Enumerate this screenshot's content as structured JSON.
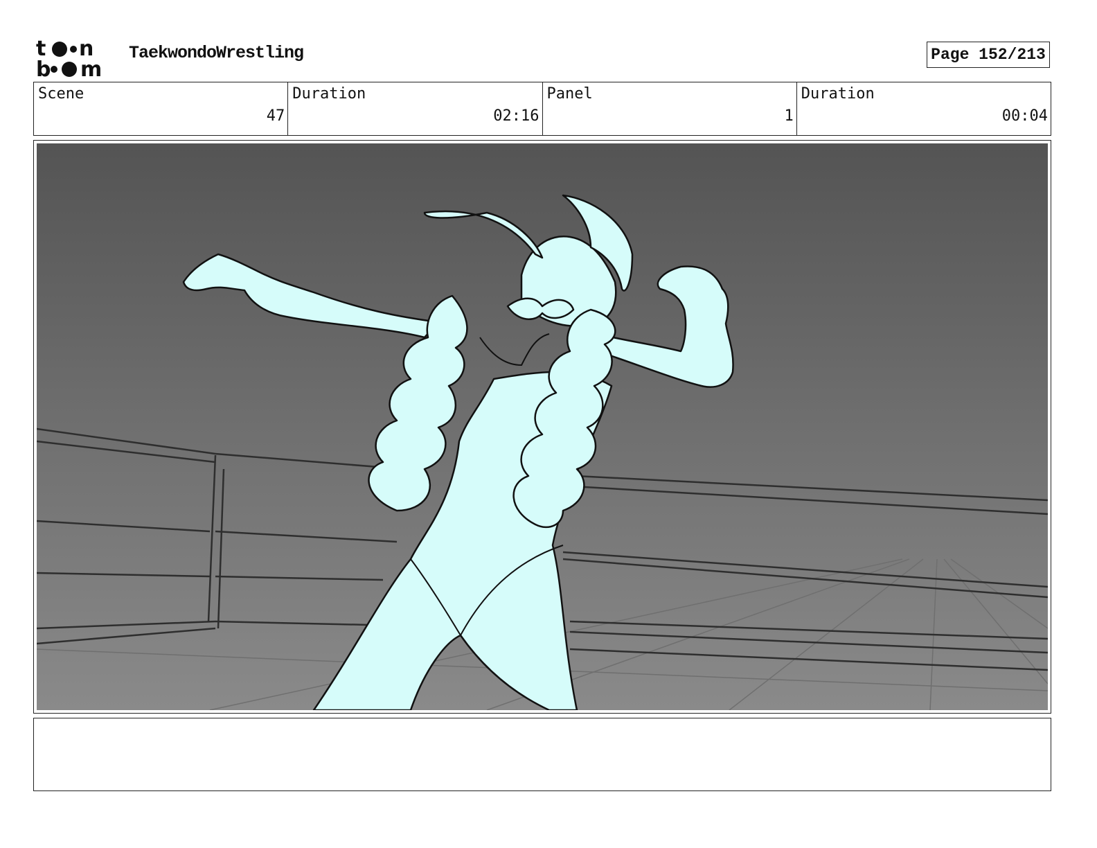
{
  "header": {
    "logo_text": "toon boom",
    "project_title": "TaekwondoWrestling",
    "page_label": "Page 152/213"
  },
  "info": {
    "scene_label": "Scene",
    "scene_value": "47",
    "scene_duration_label": "Duration",
    "scene_duration_value": "02:16",
    "panel_label": "Panel",
    "panel_value": "1",
    "panel_duration_label": "Duration",
    "panel_duration_value": "00:04"
  },
  "notes": {
    "text": ""
  },
  "colors": {
    "character_fill": "#d6fcfa",
    "background_top": "#545454",
    "background_bottom": "#8a8a8a",
    "line": "#111111"
  }
}
